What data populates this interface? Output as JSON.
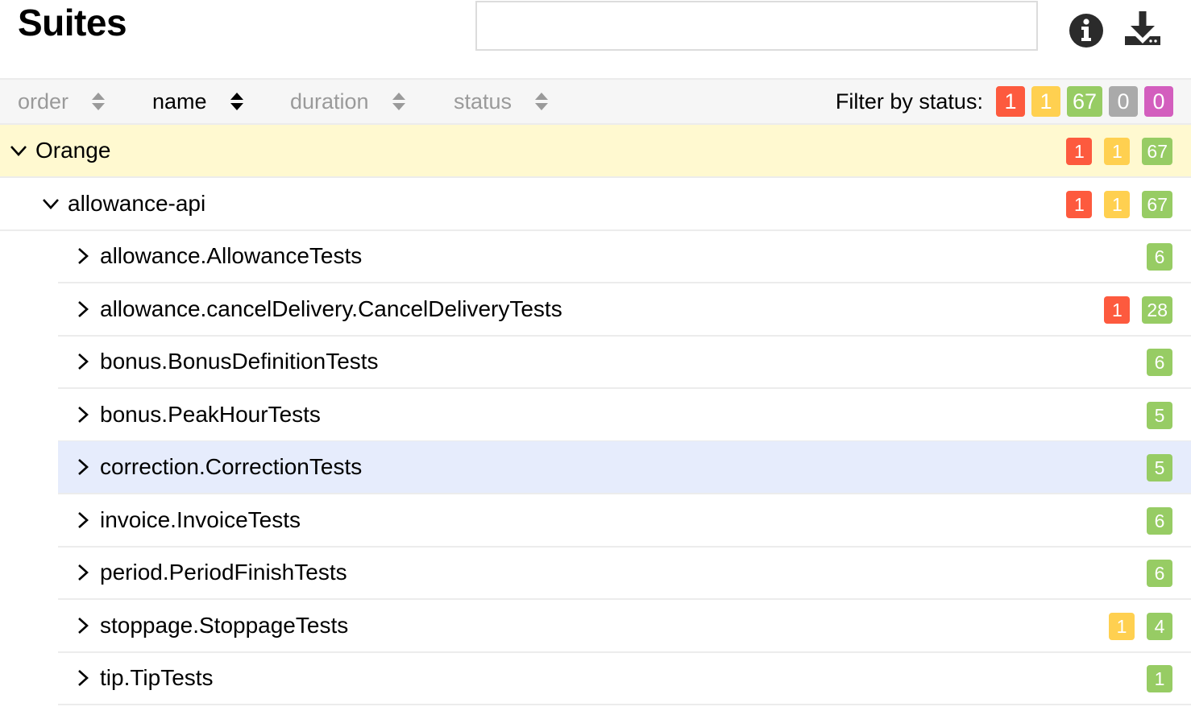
{
  "header": {
    "title": "Suites",
    "search_value": "",
    "search_placeholder": ""
  },
  "sort": [
    {
      "label": "order",
      "active": false
    },
    {
      "label": "name",
      "active": true
    },
    {
      "label": "duration",
      "active": false
    },
    {
      "label": "status",
      "active": false
    }
  ],
  "filter": {
    "label": "Filter by status:",
    "counts": {
      "failed": "1",
      "broken": "1",
      "passed": "67",
      "skipped": "0",
      "unknown": "0"
    }
  },
  "colors": {
    "failed": "#fd5a3e",
    "broken": "#ffd050",
    "passed": "#97cc64",
    "skipped": "#aaaaaa",
    "unknown": "#d35ebe",
    "group_highlight": "#fff9d0",
    "selected_row": "#e6ecfc",
    "sortbar_bg": "#f6f6f6"
  },
  "tree": [
    {
      "label": "Orange",
      "expanded": true,
      "failed": "1",
      "broken": "1",
      "passed": "67"
    },
    {
      "label": "allowance-api",
      "expanded": true,
      "failed": "1",
      "broken": "1",
      "passed": "67"
    },
    {
      "label": "allowance.AllowanceTests",
      "expanded": false,
      "failed": "",
      "broken": "",
      "passed": "6"
    },
    {
      "label": "allowance.cancelDelivery.CancelDeliveryTests",
      "expanded": false,
      "failed": "1",
      "broken": "",
      "passed": "28"
    },
    {
      "label": "bonus.BonusDefinitionTests",
      "expanded": false,
      "failed": "",
      "broken": "",
      "passed": "6"
    },
    {
      "label": "bonus.PeakHourTests",
      "expanded": false,
      "failed": "",
      "broken": "",
      "passed": "5"
    },
    {
      "label": "correction.CorrectionTests",
      "expanded": false,
      "failed": "",
      "broken": "",
      "passed": "5",
      "selected": true
    },
    {
      "label": "invoice.InvoiceTests",
      "expanded": false,
      "failed": "",
      "broken": "",
      "passed": "6"
    },
    {
      "label": "period.PeriodFinishTests",
      "expanded": false,
      "failed": "",
      "broken": "",
      "passed": "6"
    },
    {
      "label": "stoppage.StoppageTests",
      "expanded": false,
      "failed": "",
      "broken": "1",
      "passed": "4"
    },
    {
      "label": "tip.TipTests",
      "expanded": false,
      "failed": "",
      "broken": "",
      "passed": "1"
    }
  ]
}
